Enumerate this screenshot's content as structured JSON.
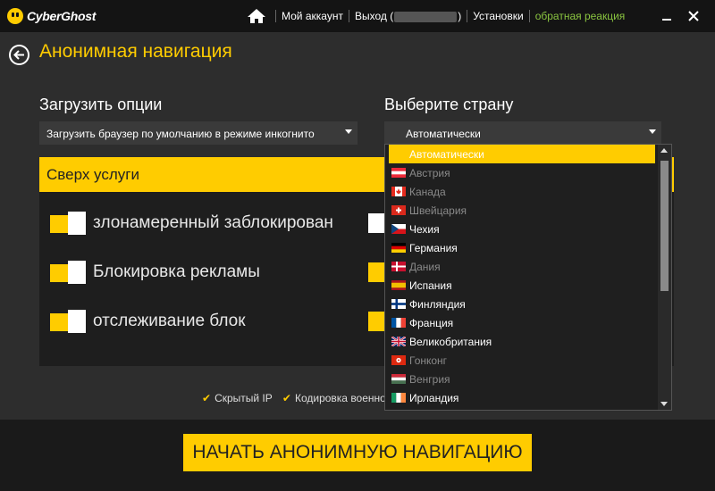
{
  "app": {
    "name": "CyberGhost"
  },
  "nav": {
    "account": "Мой аккаунт",
    "logout_prefix": "Выход (",
    "logout_suffix": ")",
    "settings": "Установки",
    "feedback": "обратная реакция"
  },
  "page": {
    "title": "Анонимная навигация"
  },
  "load_options": {
    "label": "Загрузить опции",
    "value": "Загрузить браузер по умолчанию в режиме инкогнито"
  },
  "country": {
    "label": "Выберите страну",
    "value": "Автоматически",
    "options": [
      {
        "name": "Автоматически",
        "state": "selected",
        "flag": ""
      },
      {
        "name": "Австрия",
        "state": "dim",
        "flag": "at"
      },
      {
        "name": "Канада",
        "state": "dim",
        "flag": "ca"
      },
      {
        "name": "Швейцария",
        "state": "dim",
        "flag": "ch"
      },
      {
        "name": "Чехия",
        "state": "active",
        "flag": "cz"
      },
      {
        "name": "Германия",
        "state": "active",
        "flag": "de"
      },
      {
        "name": "Дания",
        "state": "dim",
        "flag": "dk"
      },
      {
        "name": "Испания",
        "state": "active",
        "flag": "es"
      },
      {
        "name": "Финляндия",
        "state": "active",
        "flag": "fi"
      },
      {
        "name": "Франция",
        "state": "active",
        "flag": "fr"
      },
      {
        "name": "Великобритания",
        "state": "active",
        "flag": "gb"
      },
      {
        "name": "Гонконг",
        "state": "dim",
        "flag": "hk"
      },
      {
        "name": "Венгрия",
        "state": "dim",
        "flag": "hu"
      },
      {
        "name": "Ирландия",
        "state": "active",
        "flag": "ie"
      }
    ]
  },
  "services": {
    "header": "Сверх услуги",
    "items": [
      {
        "label": "злонамеренный заблокирован"
      },
      {
        "label": "Блокировка рекламы"
      },
      {
        "label": "отслеживание блок"
      }
    ]
  },
  "features": {
    "hidden_ip": "Скрытый IP",
    "encoding": "Кодировка военно"
  },
  "actions": {
    "start": "НАЧАТЬ АНОНИМНУЮ НАВИГАЦИЮ"
  },
  "colors": {
    "accent": "#ffcc00",
    "feedback": "#8ac440",
    "background": "#2d2d2d",
    "titlebar": "#141414"
  }
}
